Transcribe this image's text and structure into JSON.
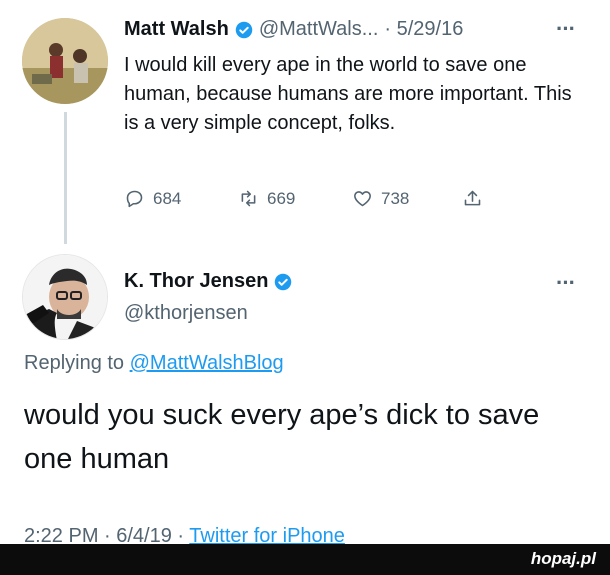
{
  "tweet1": {
    "name": "Matt Walsh",
    "handle": "@MattWals...",
    "date": "· 5/29/16",
    "more": "···",
    "text": "I would kill every ape in the world to save one human, because humans are more important. This is a very simple concept, folks.",
    "actions": {
      "reply_count": "684",
      "retweet_count": "669",
      "like_count": "738"
    }
  },
  "tweet2": {
    "name": "K. Thor Jensen",
    "handle": "@kthorjensen",
    "more": "···",
    "replying_prefix": "Replying to",
    "replying_handle": "@MattWalshBlog",
    "text": "would you suck every ape’s dick to save one human",
    "meta_time": "2:22 PM · 6/4/19 · ",
    "meta_source": "Twitter for iPhone"
  },
  "watermark": "hopaj.pl",
  "colors": {
    "accent": "#1d9bf0",
    "verified": "#1d9bf0",
    "muted": "#536471"
  }
}
